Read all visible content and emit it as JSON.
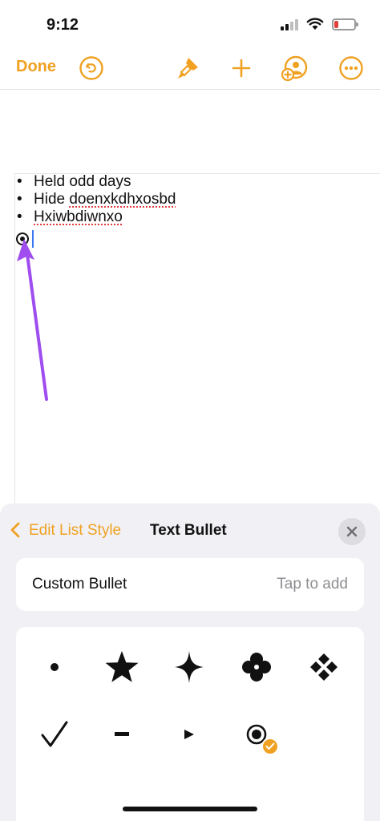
{
  "status_bar": {
    "time": "9:12"
  },
  "toolbar": {
    "done_label": "Done",
    "icons": [
      "undo-icon",
      "paintbrush-icon",
      "plus-icon",
      "collaborate-icon",
      "more-icon"
    ],
    "accent_color": "#f0a122"
  },
  "document": {
    "items": [
      "Held odd days",
      "Hide ",
      "doenxkdhxosbd",
      "Hxiwbdiwnxo"
    ]
  },
  "sheet": {
    "back_label": "Edit List Style",
    "title": "Text Bullet",
    "custom_bullet_label": "Custom Bullet",
    "custom_bullet_hint": "Tap to add",
    "bullets": [
      "dot",
      "star",
      "sparkle",
      "clover",
      "diamond-cluster",
      "checkmark",
      "dash",
      "triangle",
      "circled-dot (selected)"
    ]
  }
}
